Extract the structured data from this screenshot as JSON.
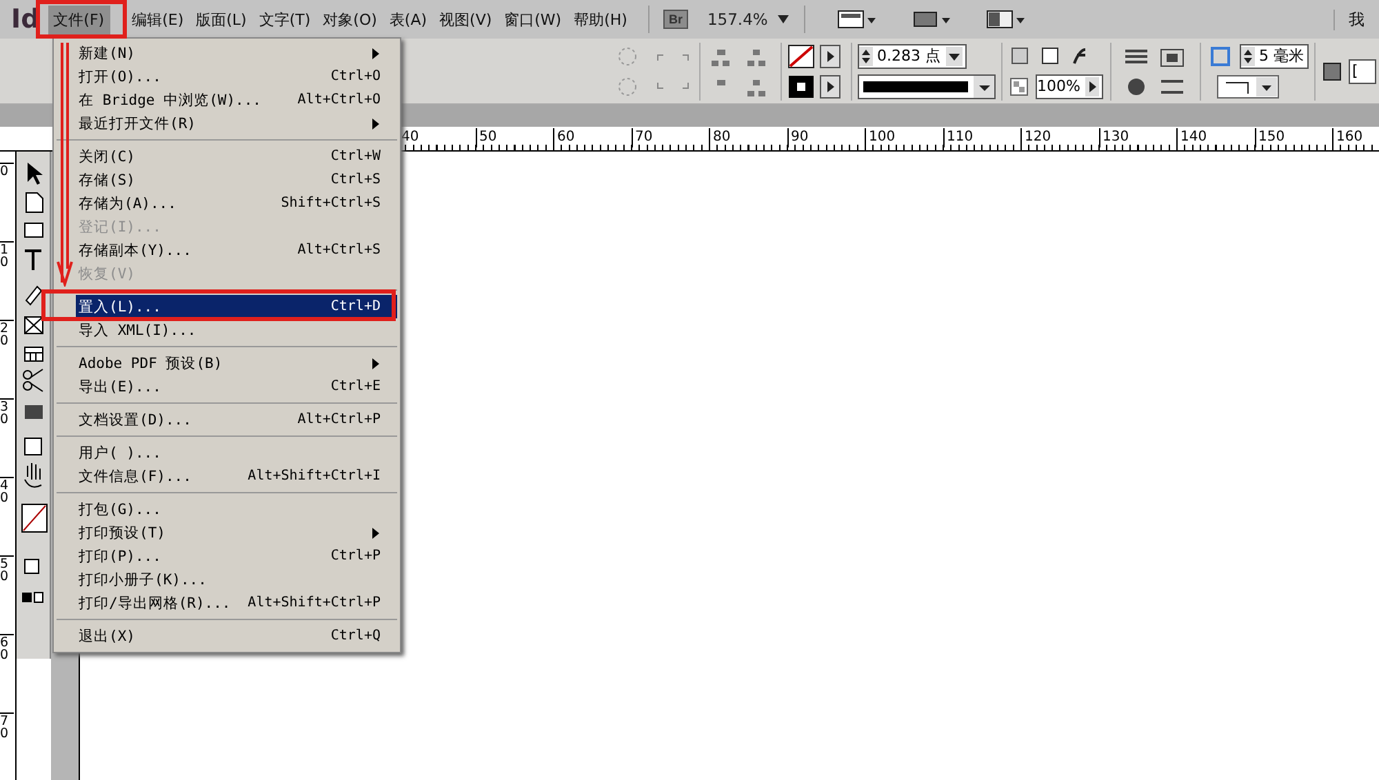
{
  "app_logo": "Id",
  "menu_bar": [
    {
      "label": "文件(F)",
      "selected": true
    },
    {
      "label": "编辑(E)",
      "selected": false
    },
    {
      "label": "版面(L)",
      "selected": false
    },
    {
      "label": "文字(T)",
      "selected": false
    },
    {
      "label": "对象(O)",
      "selected": false
    },
    {
      "label": "表(A)",
      "selected": false
    },
    {
      "label": "视图(V)",
      "selected": false
    },
    {
      "label": "窗口(W)",
      "selected": false
    },
    {
      "label": "帮助(H)",
      "selected": false
    }
  ],
  "bridge_button": "Br",
  "zoom": "157.4%",
  "workspace": "我",
  "control_panel": {
    "stroke_weight": "0.283 点",
    "opacity": "100%",
    "corner_size": "5 毫米",
    "style_field": "["
  },
  "ruler": {
    "x_labels": [
      "40",
      "50",
      "60",
      "70",
      "80",
      "90",
      "100",
      "110",
      "120",
      "130",
      "140",
      "150",
      "160"
    ],
    "y_labels": [
      "0",
      "10",
      "20",
      "30",
      "40",
      "50",
      "60",
      "70"
    ]
  },
  "file_menu": [
    [
      {
        "label": "新建(N)",
        "submenu": true,
        "disabled": false,
        "selected": false
      },
      {
        "label": "打开(O)...",
        "shortcut": "Ctrl+O",
        "submenu": false,
        "disabled": false,
        "selected": false
      },
      {
        "label": "在 Bridge 中浏览(W)...",
        "shortcut": "Alt+Ctrl+O",
        "submenu": false,
        "disabled": false,
        "selected": false
      },
      {
        "label": "最近打开文件(R)",
        "submenu": true,
        "disabled": false,
        "selected": false
      }
    ],
    [
      {
        "label": "关闭(C)",
        "shortcut": "Ctrl+W",
        "submenu": false,
        "disabled": false,
        "selected": false
      },
      {
        "label": "存储(S)",
        "shortcut": "Ctrl+S",
        "submenu": false,
        "disabled": false,
        "selected": false
      },
      {
        "label": "存储为(A)...",
        "shortcut": "Shift+Ctrl+S",
        "submenu": false,
        "disabled": false,
        "selected": false
      },
      {
        "label": "登记(I)...",
        "submenu": false,
        "disabled": true,
        "selected": false
      },
      {
        "label": "存储副本(Y)...",
        "shortcut": "Alt+Ctrl+S",
        "submenu": false,
        "disabled": false,
        "selected": false
      },
      {
        "label": "恢复(V)",
        "submenu": false,
        "disabled": true,
        "selected": false
      }
    ],
    [
      {
        "label": "置入(L)...",
        "shortcut": "Ctrl+D",
        "submenu": false,
        "disabled": false,
        "selected": true
      },
      {
        "label": "导入 XML(I)...",
        "submenu": false,
        "disabled": false,
        "selected": false
      }
    ],
    [
      {
        "label": "Adobe PDF 预设(B)",
        "submenu": true,
        "disabled": false,
        "selected": false
      },
      {
        "label": "导出(E)...",
        "shortcut": "Ctrl+E",
        "submenu": false,
        "disabled": false,
        "selected": false
      }
    ],
    [
      {
        "label": "文档设置(D)...",
        "shortcut": "Alt+Ctrl+P",
        "submenu": false,
        "disabled": false,
        "selected": false
      }
    ],
    [
      {
        "label": "用户( )...",
        "submenu": false,
        "disabled": false,
        "selected": false
      },
      {
        "label": "文件信息(F)...",
        "shortcut": "Alt+Shift+Ctrl+I",
        "submenu": false,
        "disabled": false,
        "selected": false
      }
    ],
    [
      {
        "label": "打包(G)...",
        "submenu": false,
        "disabled": false,
        "selected": false
      },
      {
        "label": "打印预设(T)",
        "submenu": true,
        "disabled": false,
        "selected": false
      },
      {
        "label": "打印(P)...",
        "shortcut": "Ctrl+P",
        "submenu": false,
        "disabled": false,
        "selected": false
      },
      {
        "label": "打印小册子(K)...",
        "submenu": false,
        "disabled": false,
        "selected": false
      },
      {
        "label": "打印/导出网格(R)...",
        "shortcut": "Alt+Shift+Ctrl+P",
        "submenu": false,
        "disabled": false,
        "selected": false
      }
    ],
    [
      {
        "label": "退出(X)",
        "shortcut": "Ctrl+Q",
        "submenu": false,
        "disabled": false,
        "selected": false
      }
    ]
  ]
}
